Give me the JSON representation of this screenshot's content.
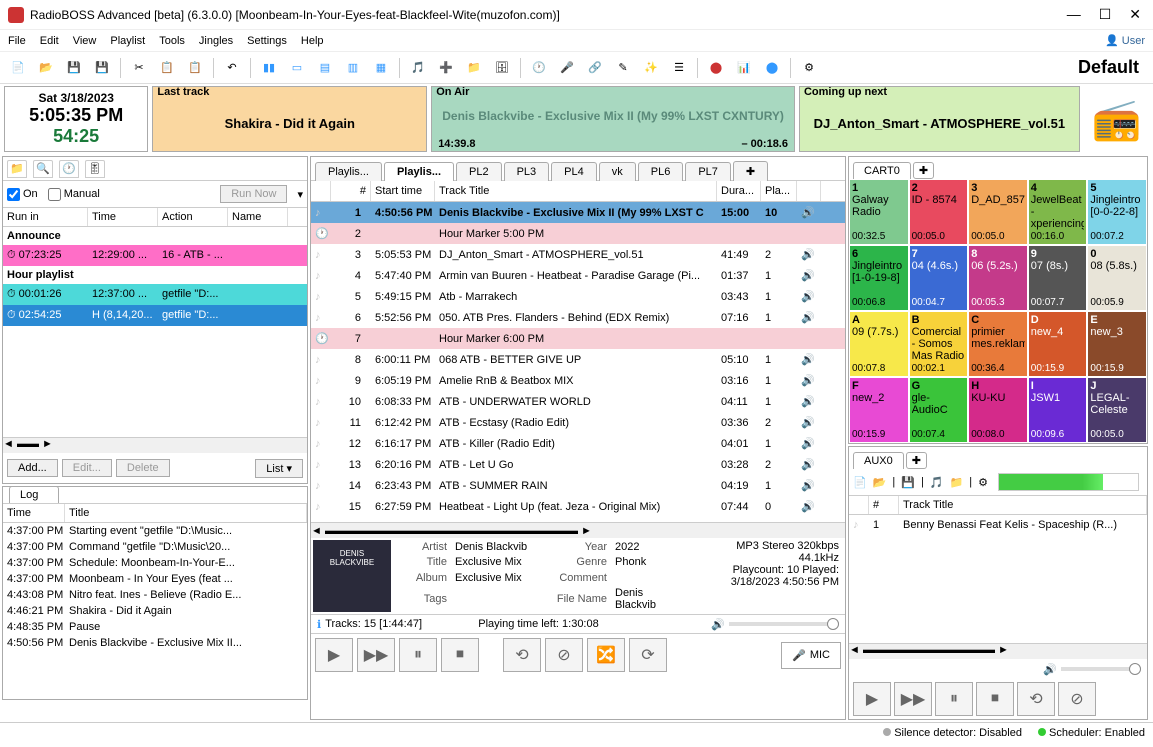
{
  "window_title": "RadioBOSS Advanced [beta] (6.3.0.0) [Moonbeam-In-Your-Eyes-feat-Blackfeel-Wite(muzofon.com)]",
  "menu": [
    "File",
    "Edit",
    "View",
    "Playlist",
    "Tools",
    "Jingles",
    "Settings",
    "Help"
  ],
  "user_label": "User",
  "profile": "Default",
  "clock": {
    "date": "Sat 3/18/2023",
    "time": "5:05:35 PM",
    "countdown": "54:25"
  },
  "last": {
    "header": "Last track",
    "text": "Shakira - Did it Again"
  },
  "onair": {
    "header": "On Air",
    "text": "Denis Blackvibe - Exclusive Mix II (My 99% LXST CXNTURY)",
    "elapsed": "14:39.8",
    "remain": "– 00:18.6"
  },
  "next": {
    "header": "Coming up next",
    "text": "DJ_Anton_Smart - ATMOSPHERE_vol.51"
  },
  "sched": {
    "on": "On",
    "manual": "Manual",
    "run": "Run Now",
    "cols": [
      "Run in",
      "Time",
      "Action",
      "Name"
    ],
    "group1": "Announce",
    "r1": [
      "07:23:25",
      "12:29:00 ...",
      "16 - ATB - ...",
      ""
    ],
    "group2": "Hour playlist",
    "r2": [
      "00:01:26",
      "12:37:00 ...",
      "getfile \"D:...",
      ""
    ],
    "r3": [
      "02:54:25",
      "H (8,14,20...",
      "getfile \"D:...",
      ""
    ],
    "btns": [
      "Add...",
      "Edit...",
      "Delete",
      "List"
    ]
  },
  "log": {
    "label": "Log",
    "cols": [
      "Time",
      "Title"
    ],
    "rows": [
      [
        "4:37:00 PM",
        "Starting event \"getfile \"D:\\Music..."
      ],
      [
        "4:37:00 PM",
        "Command \"getfile \"D:\\Music\\20..."
      ],
      [
        "4:37:00 PM",
        "Schedule: Moonbeam-In-Your-E..."
      ],
      [
        "4:37:00 PM",
        "Moonbeam - In Your Eyes (feat ..."
      ],
      [
        "4:43:08 PM",
        "Nitro feat. Ines - Believe (Radio E..."
      ],
      [
        "4:46:21 PM",
        "Shakira - Did it Again"
      ],
      [
        "4:48:35 PM",
        "Pause"
      ],
      [
        "4:50:56 PM",
        "Denis Blackvibe - Exclusive Mix II..."
      ]
    ]
  },
  "pl_tabs": [
    "Playlis...",
    "Playlis...",
    "PL2",
    "PL3",
    "PL4",
    "vk",
    "PL6",
    "PL7"
  ],
  "pl_cols": {
    "num": "#",
    "start": "Start time",
    "title": "Track Title",
    "dur": "Dura...",
    "play": "Pla..."
  },
  "pl": [
    {
      "n": "1",
      "st": "4:50:56 PM",
      "t": "Denis Blackvibe - Exclusive Mix II (My 99% LXST C",
      "d": "15:00",
      "p": "10",
      "playing": true
    },
    {
      "n": "2",
      "st": "",
      "t": "Hour Marker 5:00 PM",
      "d": "",
      "p": "",
      "marker": true
    },
    {
      "n": "3",
      "st": "5:05:53 PM",
      "t": "DJ_Anton_Smart - ATMOSPHERE_vol.51",
      "d": "41:49",
      "p": "2"
    },
    {
      "n": "4",
      "st": "5:47:40 PM",
      "t": "Armin van Buuren - Heatbeat - Paradise Garage (Pi...",
      "d": "01:37",
      "p": "1"
    },
    {
      "n": "5",
      "st": "5:49:15 PM",
      "t": "Atb - Marrakech",
      "d": "03:43",
      "p": "1"
    },
    {
      "n": "6",
      "st": "5:52:56 PM",
      "t": "050. ATB Pres. Flanders - Behind (EDX Remix)",
      "d": "07:16",
      "p": "1"
    },
    {
      "n": "7",
      "st": "",
      "t": "Hour Marker 6:00 PM",
      "d": "",
      "p": "",
      "marker": true
    },
    {
      "n": "8",
      "st": "6:00:11 PM",
      "t": "068 ATB - BETTER GIVE UP",
      "d": "05:10",
      "p": "1"
    },
    {
      "n": "9",
      "st": "6:05:19 PM",
      "t": "Amelie RnB & Beatbox MIX",
      "d": "03:16",
      "p": "1"
    },
    {
      "n": "10",
      "st": "6:08:33 PM",
      "t": "ATB - UNDERWATER WORLD",
      "d": "04:11",
      "p": "1"
    },
    {
      "n": "11",
      "st": "6:12:42 PM",
      "t": "ATB - Ecstasy (Radio Edit)",
      "d": "03:36",
      "p": "2"
    },
    {
      "n": "12",
      "st": "6:16:17 PM",
      "t": "ATB - Killer (Radio Edit)",
      "d": "04:01",
      "p": "1"
    },
    {
      "n": "13",
      "st": "6:20:16 PM",
      "t": "ATB - Let U Go",
      "d": "03:28",
      "p": "2"
    },
    {
      "n": "14",
      "st": "6:23:43 PM",
      "t": "ATB - SUMMER RAIN",
      "d": "04:19",
      "p": "1"
    },
    {
      "n": "15",
      "st": "6:27:59 PM",
      "t": "Heatbeat - Light Up (feat. Jeza - Original Mix)",
      "d": "07:44",
      "p": "0"
    }
  ],
  "meta": {
    "artist_l": "Artist",
    "artist": "Denis Blackvib",
    "title_l": "Title",
    "title": "Exclusive Mix",
    "album_l": "Album",
    "album": "Exclusive Mix",
    "tags_l": "Tags",
    "tags": "",
    "year_l": "Year",
    "year": "2022",
    "genre_l": "Genre",
    "genre": "Phonk",
    "comment_l": "Comment",
    "comment": "",
    "file_l": "File Name",
    "file": "Denis Blackvib",
    "fmt": "MP3 Stereo 320kbps",
    "rate": "44.1kHz",
    "played": "Playcount: 10  Played:",
    "pdate": "3/18/2023 4:50:56 PM"
  },
  "pl_info": {
    "tracks": "Tracks: 15 [1:44:47]",
    "left": "Playing time left: 1:30:08"
  },
  "mic": "MIC",
  "cart": {
    "tab": "CART0",
    "cells": [
      {
        "hk": "1",
        "nm": "Galway Radio",
        "tm": "00:32.5",
        "bg": "#7fc98f"
      },
      {
        "hk": "2",
        "nm": "ID - 8574",
        "tm": "00:05.0",
        "bg": "#e84a5f"
      },
      {
        "hk": "3",
        "nm": "D_AD_857",
        "tm": "00:05.0",
        "bg": "#f2a65a"
      },
      {
        "hk": "4",
        "nm": "JewelBeat - xperiencing",
        "tm": "00:16.0",
        "bg": "#7fb84a"
      },
      {
        "hk": "5",
        "nm": "Jingleintro [0-0-22-8]",
        "tm": "00:07.2",
        "bg": "#7fd4e8"
      },
      {
        "hk": "6",
        "nm": "Jingleintro [1-0-19-8]",
        "tm": "00:06.8",
        "bg": "#2cb54a"
      },
      {
        "hk": "7",
        "nm": "04 (4.6s.)",
        "tm": "00:04.7",
        "bg": "#3a6ad4"
      },
      {
        "hk": "8",
        "nm": "06 (5.2s.)",
        "tm": "00:05.3",
        "bg": "#c43a8a"
      },
      {
        "hk": "9",
        "nm": "07 (8s.)",
        "tm": "00:07.7",
        "bg": "#555"
      },
      {
        "hk": "0",
        "nm": "08 (5.8s.)",
        "tm": "00:05.9",
        "bg": "#e8e4d8"
      },
      {
        "hk": "A",
        "nm": "09 (7.7s.)",
        "tm": "00:07.8",
        "bg": "#f7e84a"
      },
      {
        "hk": "B",
        "nm": "Comercial - Somos Mas Radio",
        "tm": "00:02.1",
        "bg": "#f7d23a"
      },
      {
        "hk": "C",
        "nm": "primier mes.reklam",
        "tm": "00:36.4",
        "bg": "#e87a3a"
      },
      {
        "hk": "D",
        "nm": "new_4",
        "tm": "00:15.9",
        "bg": "#d4572a"
      },
      {
        "hk": "E",
        "nm": "new_3",
        "tm": "00:15.9",
        "bg": "#8a4a2a"
      },
      {
        "hk": "F",
        "nm": "new_2",
        "tm": "00:15.9",
        "bg": "#e84ad4"
      },
      {
        "hk": "G",
        "nm": "gle-AudioC",
        "tm": "00:07.4",
        "bg": "#3ac43a"
      },
      {
        "hk": "H",
        "nm": "KU-KU",
        "tm": "00:08.0",
        "bg": "#d42a8a"
      },
      {
        "hk": "I",
        "nm": "JSW1",
        "tm": "00:09.6",
        "bg": "#6a2ad4"
      },
      {
        "hk": "J",
        "nm": "LEGAL-Celeste",
        "tm": "00:05.0",
        "bg": "#4a3a6a"
      }
    ]
  },
  "aux": {
    "tab": "AUX0",
    "cols": {
      "num": "#",
      "title": "Track Title"
    },
    "row": {
      "n": "1",
      "t": "Benny Benassi Feat Kelis - Spaceship (R...)"
    }
  },
  "status": {
    "silence": "Silence detector: Disabled",
    "sched": "Scheduler: Enabled"
  }
}
